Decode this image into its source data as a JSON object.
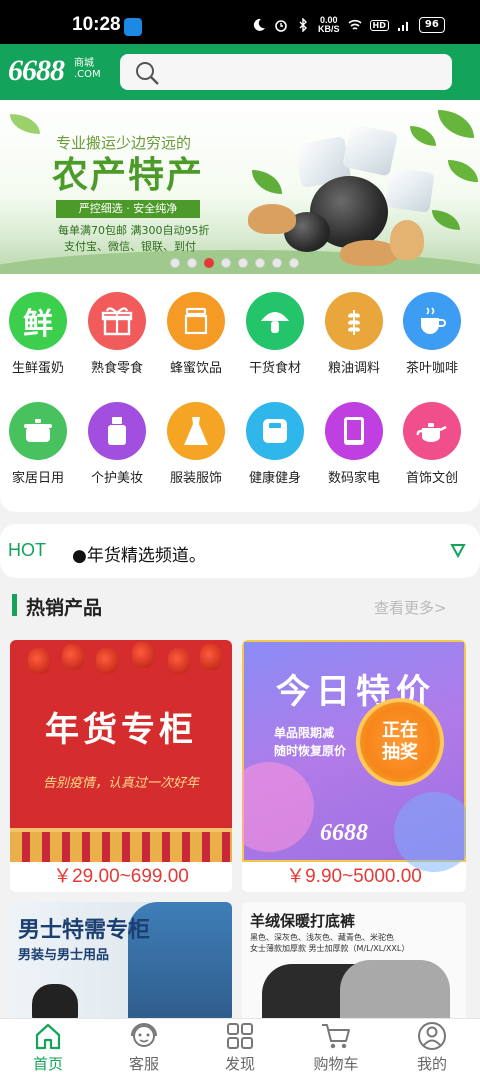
{
  "status_bar": {
    "time": "10:28",
    "net_speed_value": "0.00",
    "net_speed_unit": "KB/S",
    "hd": "HD",
    "battery": "96"
  },
  "header": {
    "logo_main": "6688",
    "logo_cn": "商城",
    "logo_com": ".COM",
    "search_placeholder": ""
  },
  "banner": {
    "top_line": "专业搬运少边穷远的",
    "title": "农产特产",
    "tag": "严控细选 · 安全纯净",
    "line1": "每单满70包邮   满300自动95折",
    "line2": "支付宝、微信、银联、到付",
    "dot_count": 8,
    "active_dot": 2
  },
  "categories": [
    {
      "label": "生鲜蛋奶",
      "icon": "fresh-icon",
      "glyph": "鲜",
      "color": "#3ccf4e"
    },
    {
      "label": "熟食零食",
      "icon": "gift-icon",
      "glyph": "🎁",
      "color": "#f25b5b"
    },
    {
      "label": "蜂蜜饮品",
      "icon": "honey-jar-icon",
      "glyph": "",
      "color": "#f59a25"
    },
    {
      "label": "干货食材",
      "icon": "mushroom-icon",
      "glyph": "",
      "color": "#23c46a"
    },
    {
      "label": "粮油调料",
      "icon": "wheat-icon",
      "glyph": "",
      "color": "#e8a63b"
    },
    {
      "label": "茶叶咖啡",
      "icon": "coffee-cup-icon",
      "glyph": "",
      "color": "#3d9df2"
    },
    {
      "label": "家居日用",
      "icon": "pot-icon",
      "glyph": "",
      "color": "#48c25e"
    },
    {
      "label": "个护美妆",
      "icon": "perfume-icon",
      "glyph": "",
      "color": "#a24fe0"
    },
    {
      "label": "服装服饰",
      "icon": "dress-icon",
      "glyph": "",
      "color": "#f5a424"
    },
    {
      "label": "健康健身",
      "icon": "scale-icon",
      "glyph": "",
      "color": "#2fb6ea"
    },
    {
      "label": "数码家电",
      "icon": "tablet-icon",
      "glyph": "",
      "color": "#c03fe0"
    },
    {
      "label": "首饰文创",
      "icon": "teapot-icon",
      "glyph": "",
      "color": "#f04f8c"
    }
  ],
  "notice": {
    "tag": "HOT",
    "text": "●年货精选频道。"
  },
  "section": {
    "title": "热销产品",
    "more": "查看更多>"
  },
  "products": [
    {
      "title": "年货专柜",
      "subtitle": "告别疫情，认真过一次好年",
      "price": "￥29.00~699.00"
    },
    {
      "title": "今日特价",
      "sub1": "单品限期减",
      "sub2": "随时恢复原价",
      "badge": "正在抽奖",
      "brand": "6688",
      "price": "￥9.90~5000.00"
    },
    {
      "title": "男士特需专柜",
      "subtitle": "男装与男士用品"
    },
    {
      "title": "羊绒保暖打底裤",
      "sub1": "黑色、深灰色、浅灰色、藏青色、米驼色",
      "sub2": "女士薄款加厚款  男士加厚款（M/L/XL/XXL）"
    }
  ],
  "bottom_nav": [
    {
      "label": "首页",
      "icon": "home-icon",
      "active": true
    },
    {
      "label": "客服",
      "icon": "customer-service-icon",
      "active": false
    },
    {
      "label": "发现",
      "icon": "discover-grid-icon",
      "active": false
    },
    {
      "label": "购物车",
      "icon": "cart-icon",
      "active": false
    },
    {
      "label": "我的",
      "icon": "profile-icon",
      "active": false
    }
  ],
  "colors": {
    "brand": "#13a35a",
    "price": "#e53935"
  }
}
